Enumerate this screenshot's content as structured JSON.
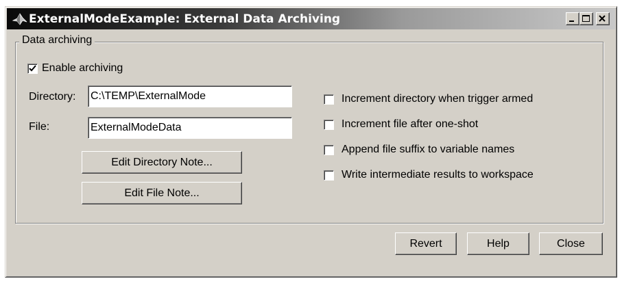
{
  "window": {
    "title": "ExternalModeExample: External Data Archiving"
  },
  "group": {
    "legend": "Data archiving"
  },
  "enable_archiving": {
    "label": "Enable archiving",
    "checked": true
  },
  "directory": {
    "label": "Directory:",
    "value": "C:\\TEMP\\ExternalMode"
  },
  "file": {
    "label": "File:",
    "value": "ExternalModeData"
  },
  "buttons": {
    "edit_directory_note": "Edit Directory Note...",
    "edit_file_note": "Edit File Note...",
    "revert": "Revert",
    "help": "Help",
    "close": "Close"
  },
  "options": [
    {
      "label": "Increment directory when trigger armed",
      "checked": false
    },
    {
      "label": "Increment file after one-shot",
      "checked": false
    },
    {
      "label": "Append file suffix to variable names",
      "checked": false
    },
    {
      "label": "Write intermediate results to workspace",
      "checked": false
    }
  ]
}
